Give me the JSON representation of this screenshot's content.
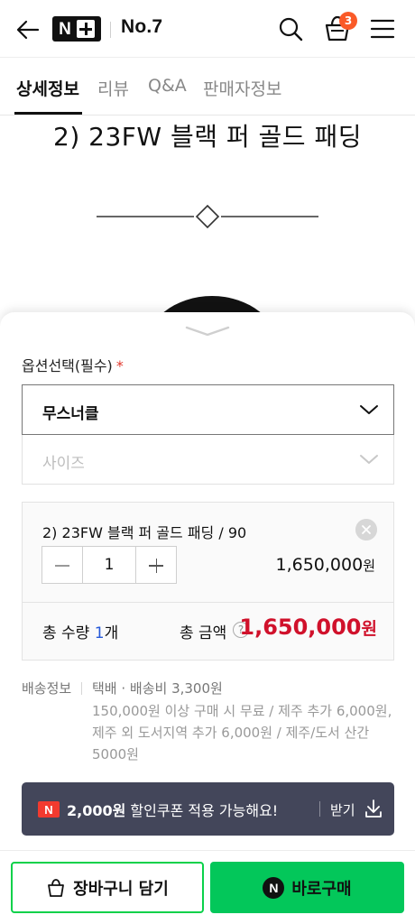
{
  "header": {
    "brand_logo": "N+",
    "store_name": "No.7",
    "cart_count": "3",
    "icons": [
      "back-arrow-icon",
      "search-icon",
      "shopping-bag-icon",
      "hamburger-menu-icon"
    ]
  },
  "tabs": [
    {
      "label": "상세정보",
      "active": true
    },
    {
      "label": "리뷰",
      "active": false
    },
    {
      "label": "Q&A",
      "active": false
    },
    {
      "label": "판매자정보",
      "active": false
    }
  ],
  "detail": {
    "title": "2) 23FW 블랙 퍼 골드 패딩"
  },
  "sheet": {
    "option_label": "옵션선택(필수)",
    "required_mark": "*",
    "select1_value": "무스너클",
    "select2_placeholder": "사이즈",
    "chosen": {
      "name": "2) 23FW 블랙 퍼 골드 패딩 / 90",
      "quantity": "1",
      "price": "1,650,000",
      "price_unit": "원"
    },
    "total_qty_prefix": "총 수량 ",
    "total_qty_num": "1",
    "total_qty_suffix": "개",
    "total_amount_label": "총 금액",
    "help_glyph": "?",
    "total_amount": "1,650,000",
    "total_amount_unit": "원",
    "shipping": {
      "label": "배송정보",
      "line1": "택배 · 배송비 3,300원",
      "line2": "150,000원 이상 구매 시 무료 / 제주 추가 6,000원, 제주 외 도서지역 추가 6,000원 / 제주/도서 산간 5000원"
    },
    "coupon": {
      "badge": "N",
      "amount": "2,000원",
      "text": " 할인쿠폰 적용 가능해요!",
      "get_label": "받기"
    }
  },
  "bottom": {
    "cart_label": "장바구니 담기",
    "buy_badge": "N",
    "buy_label": "바로구매"
  },
  "colors": {
    "accent_green": "#03c75a",
    "price_red": "#d0112b",
    "badge_orange": "#fa5a28",
    "coupon_bg": "#43465a"
  }
}
